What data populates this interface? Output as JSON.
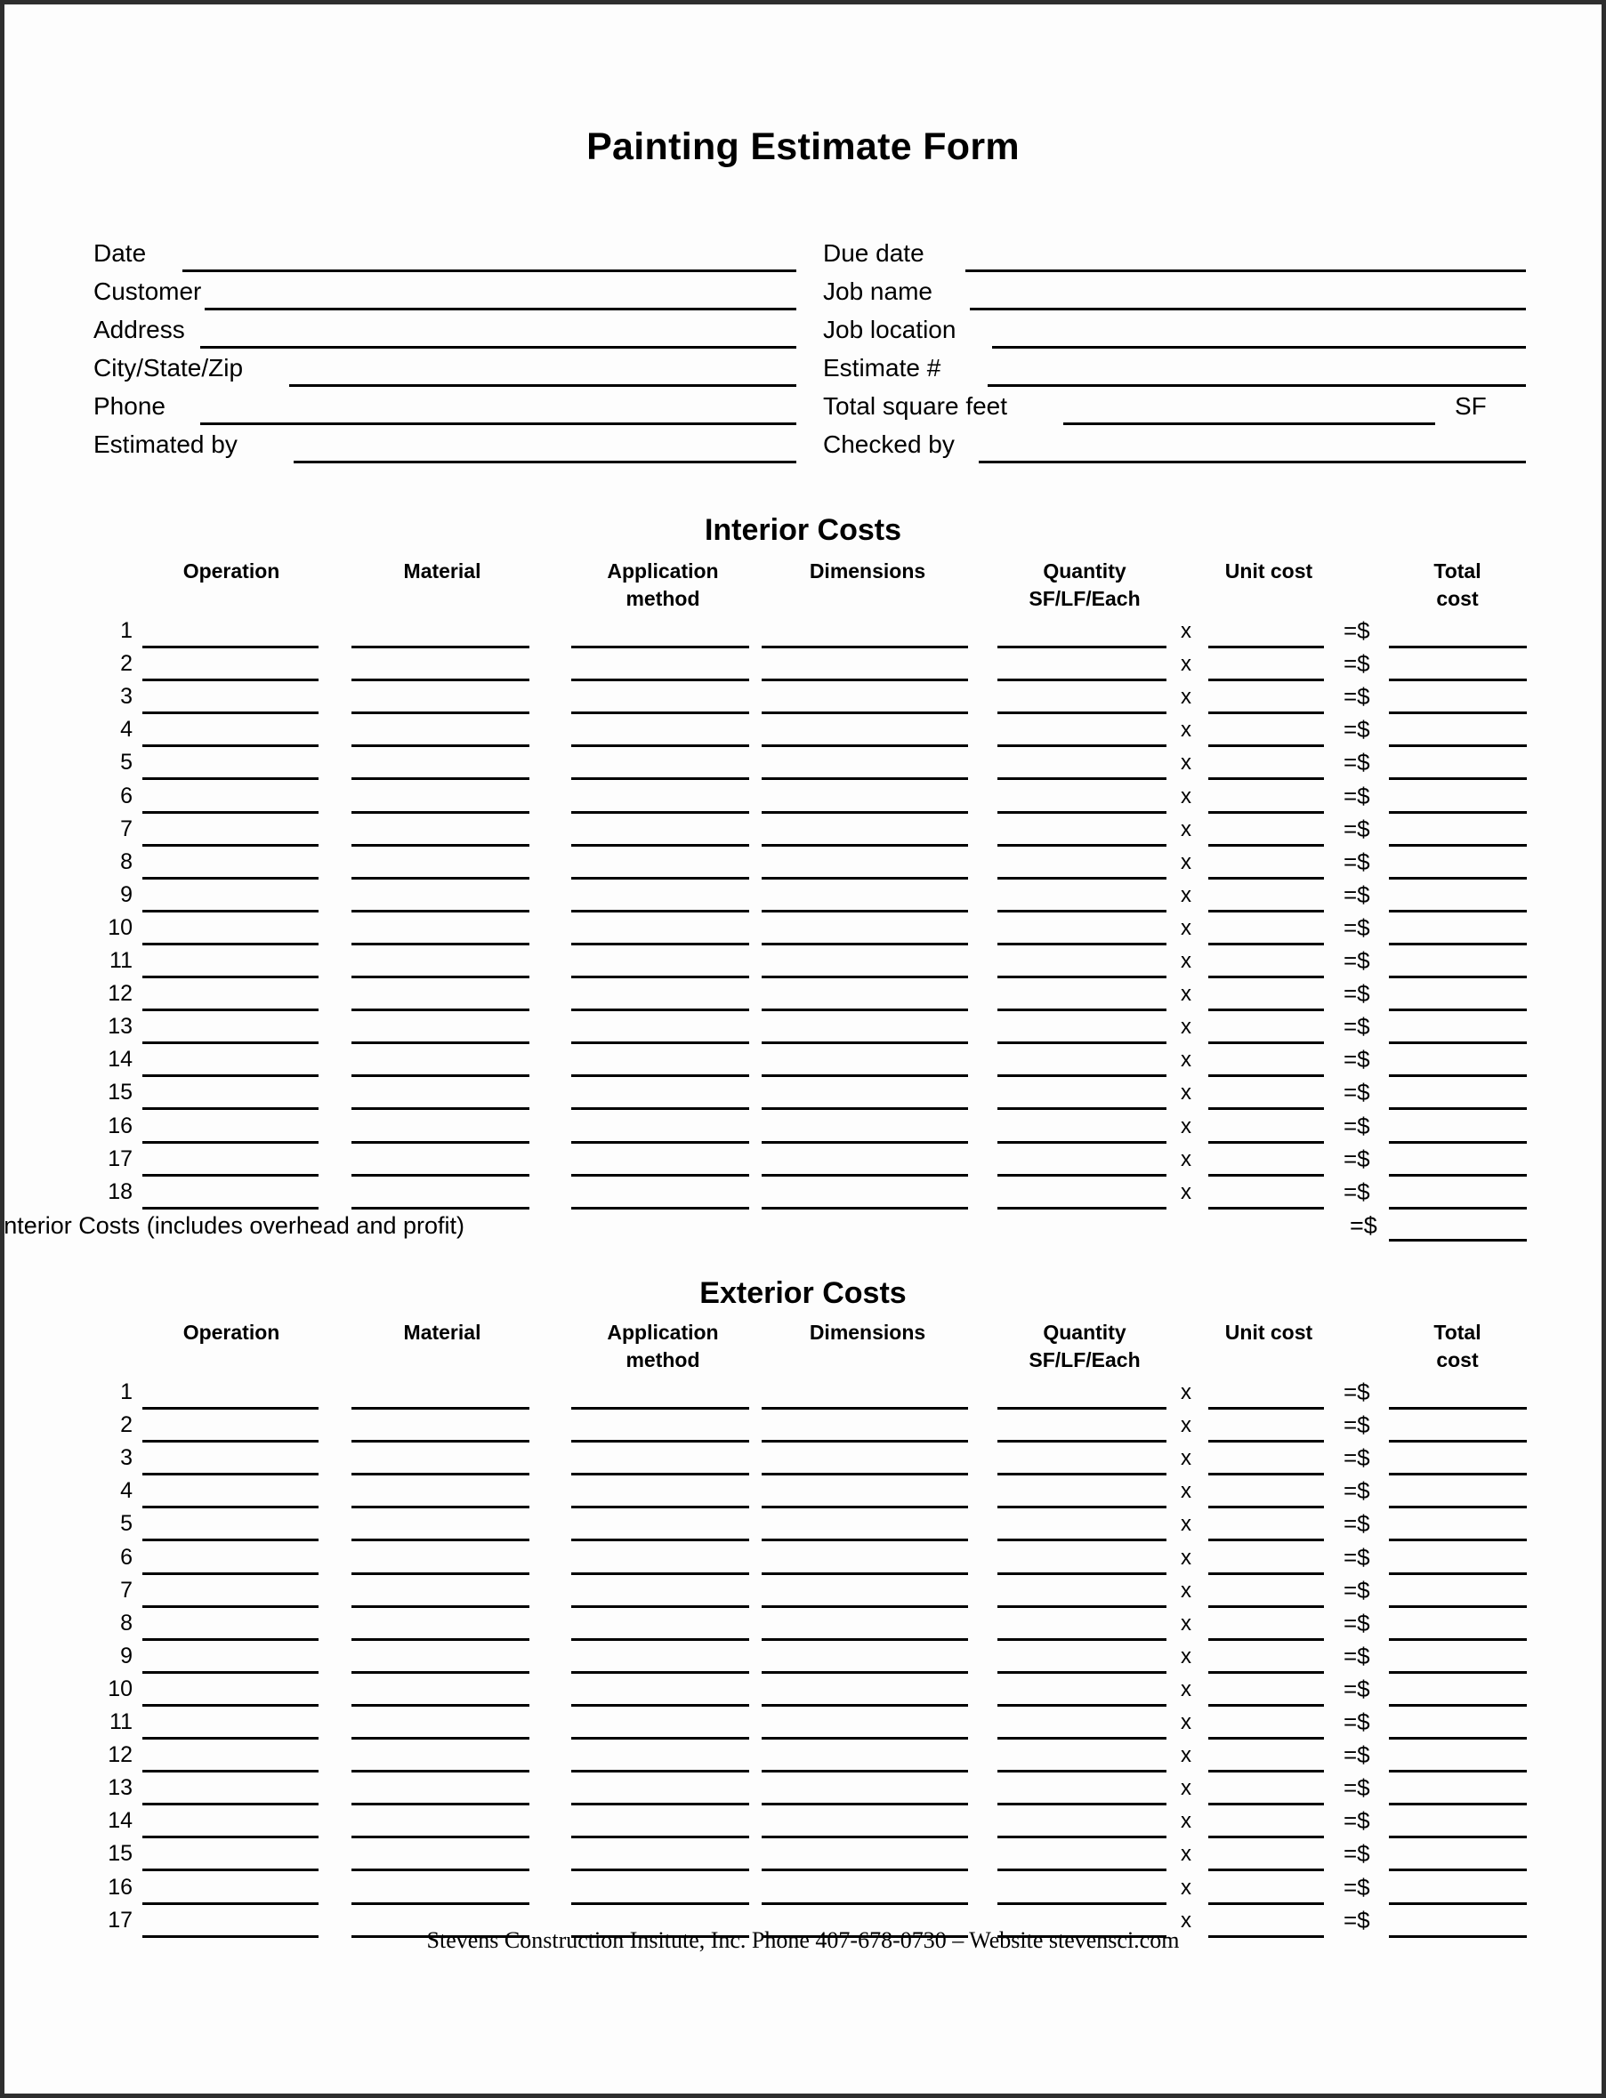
{
  "document": {
    "title": "Painting Estimate Form"
  },
  "header": {
    "left_fields": [
      {
        "label": "Date"
      },
      {
        "label": "Customer"
      },
      {
        "label": "Address"
      },
      {
        "label": "City/State/Zip"
      },
      {
        "label": "Phone"
      },
      {
        "label": "Estimated by"
      }
    ],
    "right_fields": [
      {
        "label": "Due date",
        "suffix": ""
      },
      {
        "label": "Job name",
        "suffix": ""
      },
      {
        "label": "Job location",
        "suffix": ""
      },
      {
        "label": "Estimate #",
        "suffix": ""
      },
      {
        "label": "Total square feet",
        "suffix": "SF"
      },
      {
        "label": "Checked by",
        "suffix": ""
      }
    ]
  },
  "columns": {
    "operation": "Operation",
    "material": "Material",
    "application_method_line1": "Application",
    "application_method_line2": "method",
    "dimensions": "Dimensions",
    "quantity_line1": "Quantity",
    "quantity_line2": "SF/LF/Each",
    "unit_cost": "Unit cost",
    "total_cost_line1": "Total",
    "total_cost_line2": "cost"
  },
  "operators": {
    "multiply": "x",
    "equals_dollar": "=$"
  },
  "interior": {
    "section_title": "Interior Costs",
    "row_numbers": [
      "1",
      "2",
      "3",
      "4",
      "5",
      "6",
      "7",
      "8",
      "9",
      "10",
      "11",
      "12",
      "13",
      "14",
      "15",
      "16",
      "17",
      "18"
    ],
    "total_label": "Total Interior Costs (includes overhead and profit)",
    "total_equals": "=$"
  },
  "exterior": {
    "section_title": "Exterior Costs",
    "row_numbers": [
      "1",
      "2",
      "3",
      "4",
      "5",
      "6",
      "7",
      "8",
      "9",
      "10",
      "11",
      "12",
      "13",
      "14",
      "15",
      "16",
      "17"
    ]
  },
  "footer": {
    "text": "Stevens Construction Insitute, Inc. Phone 407-678-0730 – Website stevensci.com"
  },
  "colors": {
    "ink": "#000000",
    "paper": "#fdfdfd",
    "frame": "#2e2e2e"
  }
}
